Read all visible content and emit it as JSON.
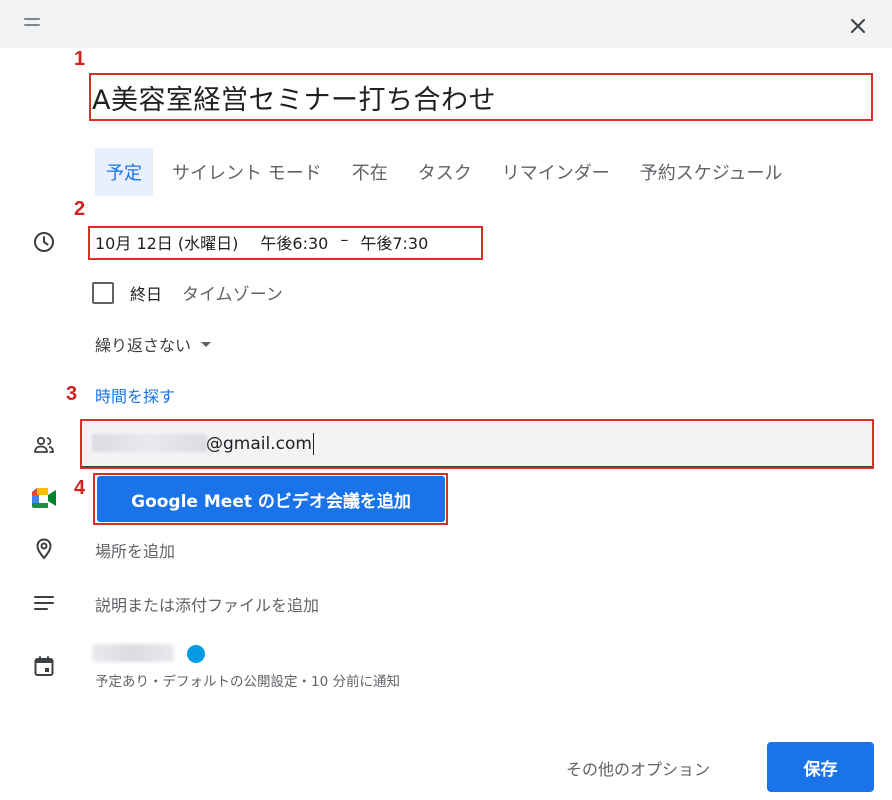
{
  "event": {
    "title": "A美容室経営セミナー打ち合わせ"
  },
  "tabs": [
    {
      "label": "予定",
      "active": true
    },
    {
      "label": "サイレント モード",
      "active": false
    },
    {
      "label": "不在",
      "active": false
    },
    {
      "label": "タスク",
      "active": false
    },
    {
      "label": "リマインダー",
      "active": false
    },
    {
      "label": "予約スケジュール",
      "active": false
    }
  ],
  "datetime": {
    "date": "10月 12日 (水曜日)",
    "start": "午後6:30",
    "separator": "–",
    "end": "午後7:30"
  },
  "allday": {
    "label": "終日",
    "checked": false,
    "timezone_label": "タイムゾーン"
  },
  "repeat": {
    "value": "繰り返さない"
  },
  "find_time": {
    "label": "時間を探す"
  },
  "guests": {
    "value_suffix": "@gmail.com"
  },
  "meet": {
    "button_label": "Google Meet のビデオ会議を追加"
  },
  "location": {
    "placeholder": "場所を追加"
  },
  "description": {
    "placeholder": "説明または添付ファイルを追加"
  },
  "calendar": {
    "color": "#039be5",
    "details": "予定あり・デフォルトの公開設定・10 分前に通知"
  },
  "footer": {
    "more_options": "その他のオプション",
    "save": "保存"
  },
  "annotations": {
    "step1": "1",
    "step2": "2",
    "step3": "3",
    "step4": "4"
  },
  "icons": {
    "drag": "drag-handle-icon",
    "close": "close-icon",
    "time": "clock-icon",
    "guests": "people-icon",
    "meet": "google-meet-icon",
    "location": "location-pin-icon",
    "description": "notes-icon",
    "calendar": "calendar-icon"
  },
  "colors": {
    "accent": "#1a73e8",
    "annotation": "#d93025"
  }
}
